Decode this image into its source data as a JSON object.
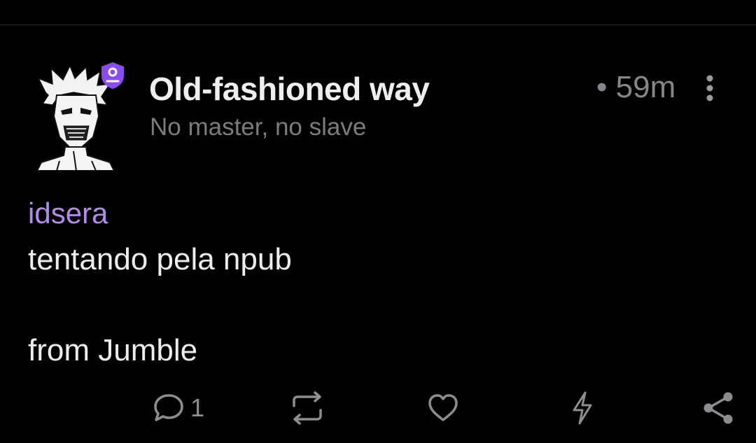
{
  "post": {
    "author_name": "Old-fashioned way",
    "author_about": "No master, no slave",
    "time_ago": "• 59m",
    "mention": "idsera",
    "content_line1": "tentando pela npub",
    "content_line2": "from Jumble"
  },
  "actions": {
    "reply_count": "1"
  },
  "icons": {
    "badge": "verified-user-badge-icon",
    "more": "more-vertical-icon",
    "reply": "comment-icon",
    "repost": "repost-icon",
    "like": "heart-icon",
    "zap": "zap-icon",
    "share": "share-icon"
  },
  "colors": {
    "background": "#000000",
    "accent": "#b28ce8",
    "badge": "#8a4bf0",
    "muted": "#7c7c80"
  }
}
